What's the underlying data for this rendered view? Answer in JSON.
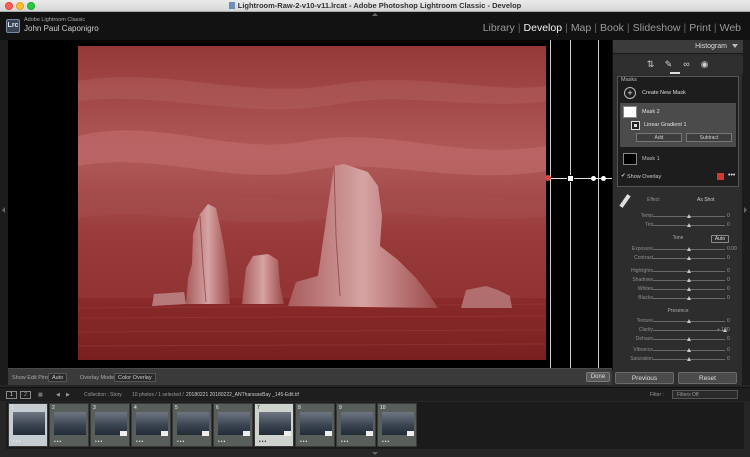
{
  "window": {
    "title": "Lightroom-Raw-2-v10-v11.lrcat - Adobe Photoshop Lightroom Classic - Develop"
  },
  "identity": {
    "logo": "Lrc",
    "app_name": "Adobe Lightroom Classic",
    "user_name": "John Paul Caponigro"
  },
  "modules": [
    "Library",
    "Develop",
    "Map",
    "Book",
    "Slideshow",
    "Print",
    "Web"
  ],
  "active_module": "Develop",
  "right_panel": {
    "histogram_label": "Histogram",
    "mask_panel": {
      "title": "Masks",
      "create_label": "Create New Mask",
      "mask2_label": "Mask 2",
      "component_label": "Linear Gradient 1",
      "add_label": "Add",
      "subtract_label": "Subtract",
      "mask1_label": "Mask 1",
      "show_overlay_label": "Show Overlay",
      "overlay_color": "#d03b2f"
    },
    "effect_label": "Effect",
    "effect_value": "As Shot",
    "sliders_top": [
      {
        "label": "Temp",
        "value": "0"
      },
      {
        "label": "Tint",
        "value": "0"
      }
    ],
    "tone_group": {
      "title": "Tone",
      "auto_label": "Auto"
    },
    "sliders_tone": [
      {
        "label": "Exposure",
        "value": "0.00"
      },
      {
        "label": "Contrast",
        "value": "0"
      },
      {
        "label": "Highlights",
        "value": "0"
      },
      {
        "label": "Shadows",
        "value": "0"
      },
      {
        "label": "Whites",
        "value": "0"
      },
      {
        "label": "Blacks",
        "value": "0"
      }
    ],
    "presence_group": {
      "title": "Presence"
    },
    "sliders_presence": [
      {
        "label": "Texture",
        "value": "0"
      },
      {
        "label": "Clarity",
        "value": "+ 100"
      },
      {
        "label": "Dehaze",
        "value": "0"
      },
      {
        "label": "Vibrance",
        "value": "0"
      },
      {
        "label": "Saturation",
        "value": "0"
      }
    ],
    "previous_label": "Previous",
    "reset_label": "Reset"
  },
  "toolbar": {
    "show_edit_pins_label": "Show Edit Pins :",
    "show_edit_pins_value": "Auto",
    "overlay_mode_label": "Overlay Mode :",
    "overlay_mode_value": "Color Overlay",
    "done_label": "Done"
  },
  "filmstrip_bar": {
    "screen1": "1",
    "screen2": "2",
    "collection_text": "Collection : Story",
    "count_text": "10 photos / 1 selected /",
    "filename": "20180221 20180222_ANTharssseBay _145-Edit.tif",
    "filter_label": "Filter :",
    "filter_value": "Filters Off"
  },
  "filmstrip": [
    {
      "index": "1",
      "pips": "•••",
      "state": "primary"
    },
    {
      "index": "2",
      "pips": "•••",
      "state": "normal"
    },
    {
      "index": "3",
      "pips": "•••",
      "state": "normal"
    },
    {
      "index": "4",
      "pips": "•••",
      "state": "normal"
    },
    {
      "index": "5",
      "pips": "•••",
      "state": "normal"
    },
    {
      "index": "6",
      "pips": "•••",
      "state": "normal"
    },
    {
      "index": "7",
      "pips": "•••",
      "state": "sel"
    },
    {
      "index": "8",
      "pips": "•••",
      "state": "normal"
    },
    {
      "index": "9",
      "pips": "•••",
      "state": "normal"
    },
    {
      "index": "10",
      "pips": "•••",
      "state": "normal"
    }
  ]
}
